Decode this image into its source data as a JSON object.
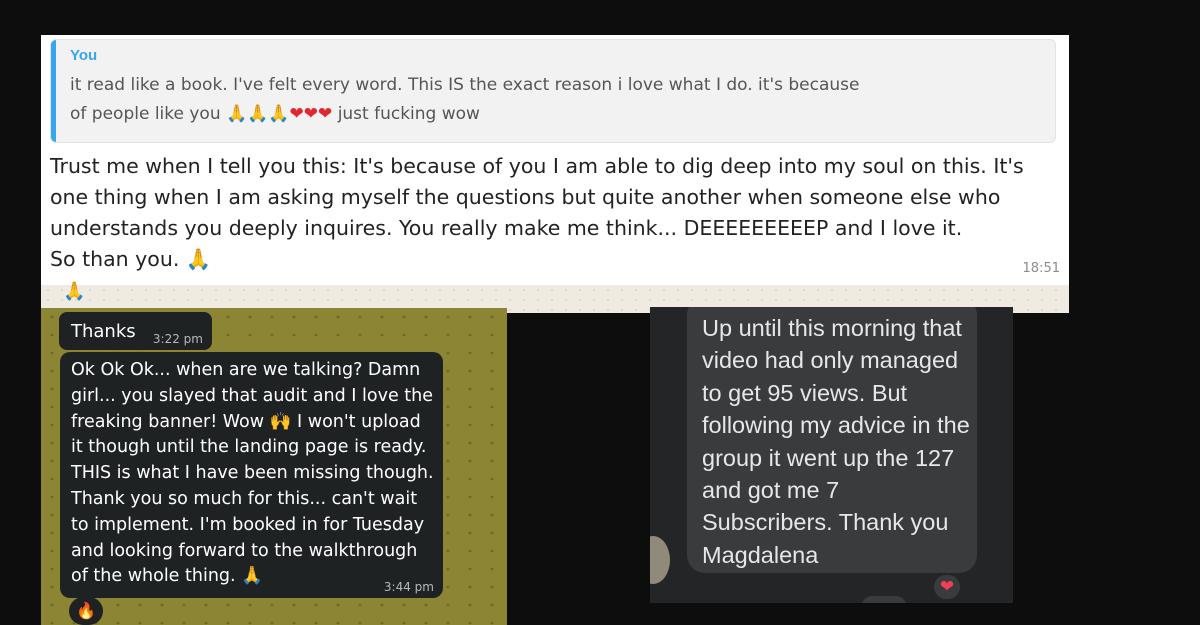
{
  "card_whatsapp": {
    "quote": {
      "author": "You",
      "text_line1": "it read like a book. I've felt every word. This IS the exact reason i love what I do. it's because",
      "text_line2_prefix": "of people like you",
      "emoji_pray": "🙏",
      "emoji_heart": "❤",
      "text_line2_suffix": "just fucking wow"
    },
    "message": {
      "text_main": "Trust me when I tell you this: It's because of you I am able to dig deep into my soul on this. It's one thing when I am asking myself the questions but quite another when someone else who understands you deeply inquires. You really make me think... DEEEEEEEEEP and I love it.",
      "text_last": "So than you.",
      "emoji": "🙏",
      "time": "18:51"
    },
    "reaction": "🙏"
  },
  "card_dark_chat": {
    "short_message": {
      "text": "Thanks",
      "time": "3:22 pm"
    },
    "long_message": {
      "text_a": "Ok Ok Ok... when are we talking? Damn girl... you slayed that audit and I love the freaking banner! Wow",
      "emoji_hands": "🙌",
      "text_b": "I won't upload it though until the landing page is ready. THIS is what I have been missing though. Thank you so much for this... can't wait to implement. I'm booked in for Tuesday and looking forward to the walkthrough of the whole thing.",
      "emoji_pray": "🙏",
      "time": "3:44 pm"
    },
    "reaction": "🔥"
  },
  "card_facebook": {
    "comment": "Up until this morning that video had only managed to get 95 views.  But following my advice in the group it went up the 127 and got me 7 Subscribers. Thank you Magdalena",
    "reaction": "❤"
  }
}
